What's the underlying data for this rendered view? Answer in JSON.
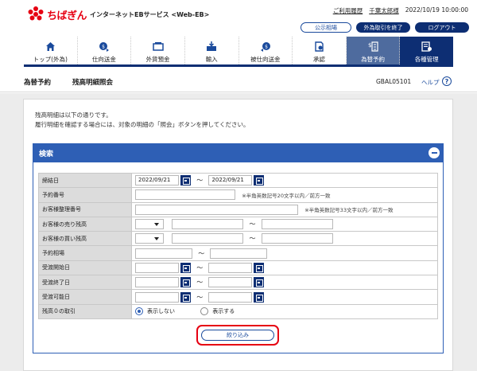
{
  "header": {
    "brand": "ちばぎん",
    "service": "インターネットEBサービス <Web-EB>",
    "usage_history": "ご利用履歴",
    "user": "千葉太郎様",
    "datetime": "2022/10/19 10:00:00",
    "public_rates": "公示相場",
    "fx_end": "外為取引を終了",
    "logout": "ログアウト"
  },
  "nav": [
    {
      "label": "トップ(外為)",
      "icon": "home-icon"
    },
    {
      "label": "仕向送金",
      "icon": "remit-icon"
    },
    {
      "label": "外貨預金",
      "icon": "deposit-icon"
    },
    {
      "label": "輸入",
      "icon": "import-icon"
    },
    {
      "label": "被仕向送金",
      "icon": "receive-icon"
    },
    {
      "label": "承認",
      "icon": "approve-icon"
    },
    {
      "label": "為替予約",
      "icon": "exchange-icon"
    },
    {
      "label": "各種管理",
      "icon": "manage-icon"
    }
  ],
  "title": {
    "section": "為替予約",
    "page": "残高明細照会",
    "code": "GBAL05101",
    "help": "ヘルプ"
  },
  "description": [
    "残高明細は以下の通りです。",
    "履行明細を確認する場合には、対象の明細の「照会」ボタンを押してください。"
  ],
  "search": {
    "title": "検索",
    "rows": {
      "base_date": {
        "label": "締結日",
        "from": "2022/09/21",
        "to": "2022/09/21"
      },
      "reservation_no": {
        "label": "予約番号",
        "note": "※半角英数記号20文字以内／前方一致"
      },
      "customer_ref": {
        "label": "お客様整理番号",
        "note": "※半角英数記号33文字以内／前方一致"
      },
      "sell_balance": {
        "label": "お客様の売り残高"
      },
      "buy_balance": {
        "label": "お客様の買い残高"
      },
      "rate": {
        "label": "予約相場"
      },
      "delivery_start": {
        "label": "受渡開始日"
      },
      "delivery_end": {
        "label": "受渡終了日"
      },
      "delivery_possible": {
        "label": "受渡可能日"
      },
      "zero_balance": {
        "label": "残高０の取引",
        "option_hide": "表示しない",
        "option_show": "表示する"
      }
    },
    "tilde": "～",
    "submit": "絞り込み"
  }
}
